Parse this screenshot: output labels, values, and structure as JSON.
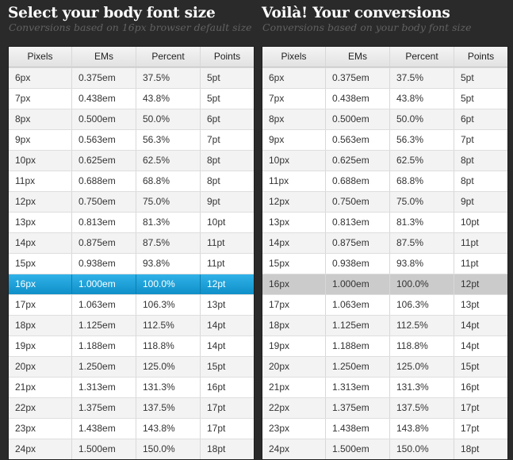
{
  "left_panel": {
    "title": "Select your body font size",
    "subtitle": "Conversions based on 16px browser default size"
  },
  "right_panel": {
    "title": "Voilà! Your conversions",
    "subtitle": "Conversions based on your body font size"
  },
  "columns": [
    "Pixels",
    "EMs",
    "Percent",
    "Points"
  ],
  "selected_index": 10,
  "colors": {
    "selected_row": "#1aa0d8",
    "base_row": "#cbcbcb",
    "background": "#2a2a2a"
  },
  "rows": [
    {
      "px": "6px",
      "em": "0.375em",
      "pct": "37.5%",
      "pt": "5pt"
    },
    {
      "px": "7px",
      "em": "0.438em",
      "pct": "43.8%",
      "pt": "5pt"
    },
    {
      "px": "8px",
      "em": "0.500em",
      "pct": "50.0%",
      "pt": "6pt"
    },
    {
      "px": "9px",
      "em": "0.563em",
      "pct": "56.3%",
      "pt": "7pt"
    },
    {
      "px": "10px",
      "em": "0.625em",
      "pct": "62.5%",
      "pt": "8pt"
    },
    {
      "px": "11px",
      "em": "0.688em",
      "pct": "68.8%",
      "pt": "8pt"
    },
    {
      "px": "12px",
      "em": "0.750em",
      "pct": "75.0%",
      "pt": "9pt"
    },
    {
      "px": "13px",
      "em": "0.813em",
      "pct": "81.3%",
      "pt": "10pt"
    },
    {
      "px": "14px",
      "em": "0.875em",
      "pct": "87.5%",
      "pt": "11pt"
    },
    {
      "px": "15px",
      "em": "0.938em",
      "pct": "93.8%",
      "pt": "11pt"
    },
    {
      "px": "16px",
      "em": "1.000em",
      "pct": "100.0%",
      "pt": "12pt"
    },
    {
      "px": "17px",
      "em": "1.063em",
      "pct": "106.3%",
      "pt": "13pt"
    },
    {
      "px": "18px",
      "em": "1.125em",
      "pct": "112.5%",
      "pt": "14pt"
    },
    {
      "px": "19px",
      "em": "1.188em",
      "pct": "118.8%",
      "pt": "14pt"
    },
    {
      "px": "20px",
      "em": "1.250em",
      "pct": "125.0%",
      "pt": "15pt"
    },
    {
      "px": "21px",
      "em": "1.313em",
      "pct": "131.3%",
      "pt": "16pt"
    },
    {
      "px": "22px",
      "em": "1.375em",
      "pct": "137.5%",
      "pt": "17pt"
    },
    {
      "px": "23px",
      "em": "1.438em",
      "pct": "143.8%",
      "pt": "17pt"
    },
    {
      "px": "24px",
      "em": "1.500em",
      "pct": "150.0%",
      "pt": "18pt"
    }
  ]
}
